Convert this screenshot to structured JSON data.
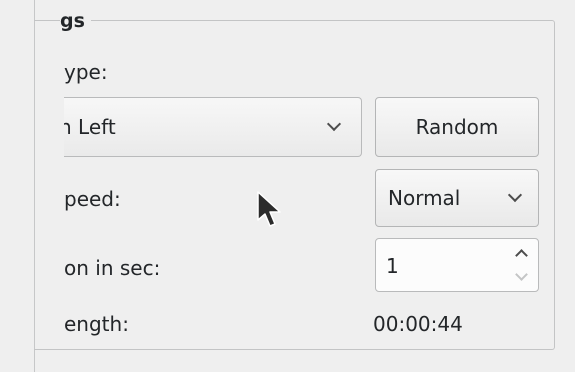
{
  "group": {
    "title": "gs"
  },
  "type_row": {
    "label": "ype:",
    "value": "n Left",
    "random_label": "Random"
  },
  "speed_row": {
    "label": "peed:",
    "value": "Normal"
  },
  "duration_row": {
    "label": "on in sec:",
    "value": "1"
  },
  "length_row": {
    "label": "ength:",
    "value": "00:00:44"
  },
  "icons": {
    "combo_arrow": "chevron-down-icon",
    "spin_up": "chevron-up-icon",
    "spin_down": "chevron-down-icon",
    "pointer": "mouse-pointer-icon"
  },
  "colors": {
    "window_bg": "#efefef",
    "text": "#232629",
    "border": "#b9babb"
  }
}
